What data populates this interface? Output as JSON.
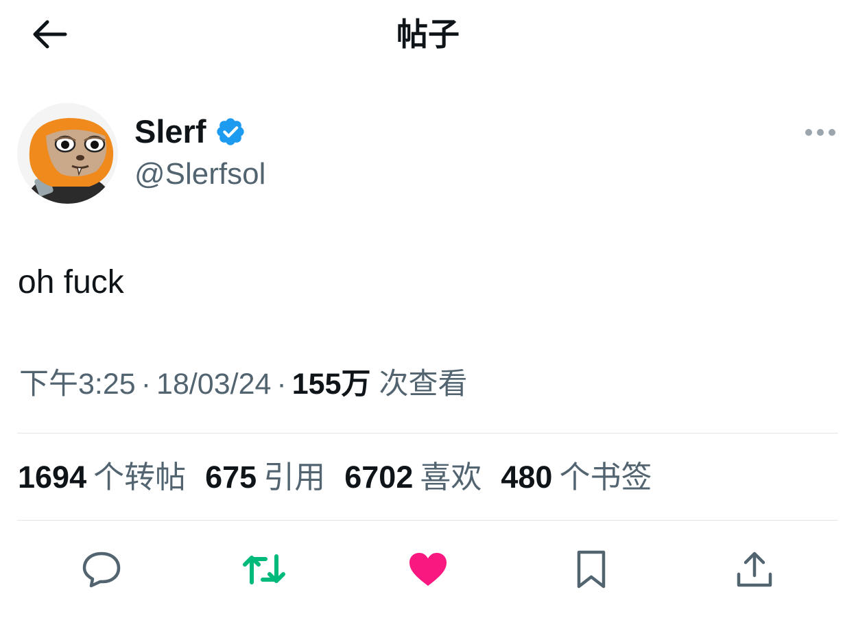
{
  "header": {
    "title": "帖子",
    "back_icon": "arrow-left-icon"
  },
  "author": {
    "name": "Slerf",
    "handle": "@Slerfsol",
    "verified": true,
    "verified_color": "#1d9bf0",
    "more_icon": "ellipsis-icon"
  },
  "tweet": {
    "text": "oh fuck"
  },
  "meta": {
    "time": "下午3:25",
    "separator": "·",
    "date": "18/03/24",
    "views_count": "155万",
    "views_label": "次查看"
  },
  "stats": [
    {
      "count": "1694",
      "label": "个转帖"
    },
    {
      "count": "675",
      "label": "引用"
    },
    {
      "count": "6702",
      "label": "喜欢"
    },
    {
      "count": "480",
      "label": "个书签"
    }
  ],
  "actions": {
    "reply_icon": "reply-icon",
    "retweet_icon": "retweet-icon",
    "like_icon": "heart-icon",
    "bookmark_icon": "bookmark-icon",
    "share_icon": "share-icon"
  },
  "colors": {
    "retweet_active": "#00ba7c",
    "like_active": "#f91880",
    "secondary_text": "#536471",
    "icon_gray": "#536471"
  }
}
